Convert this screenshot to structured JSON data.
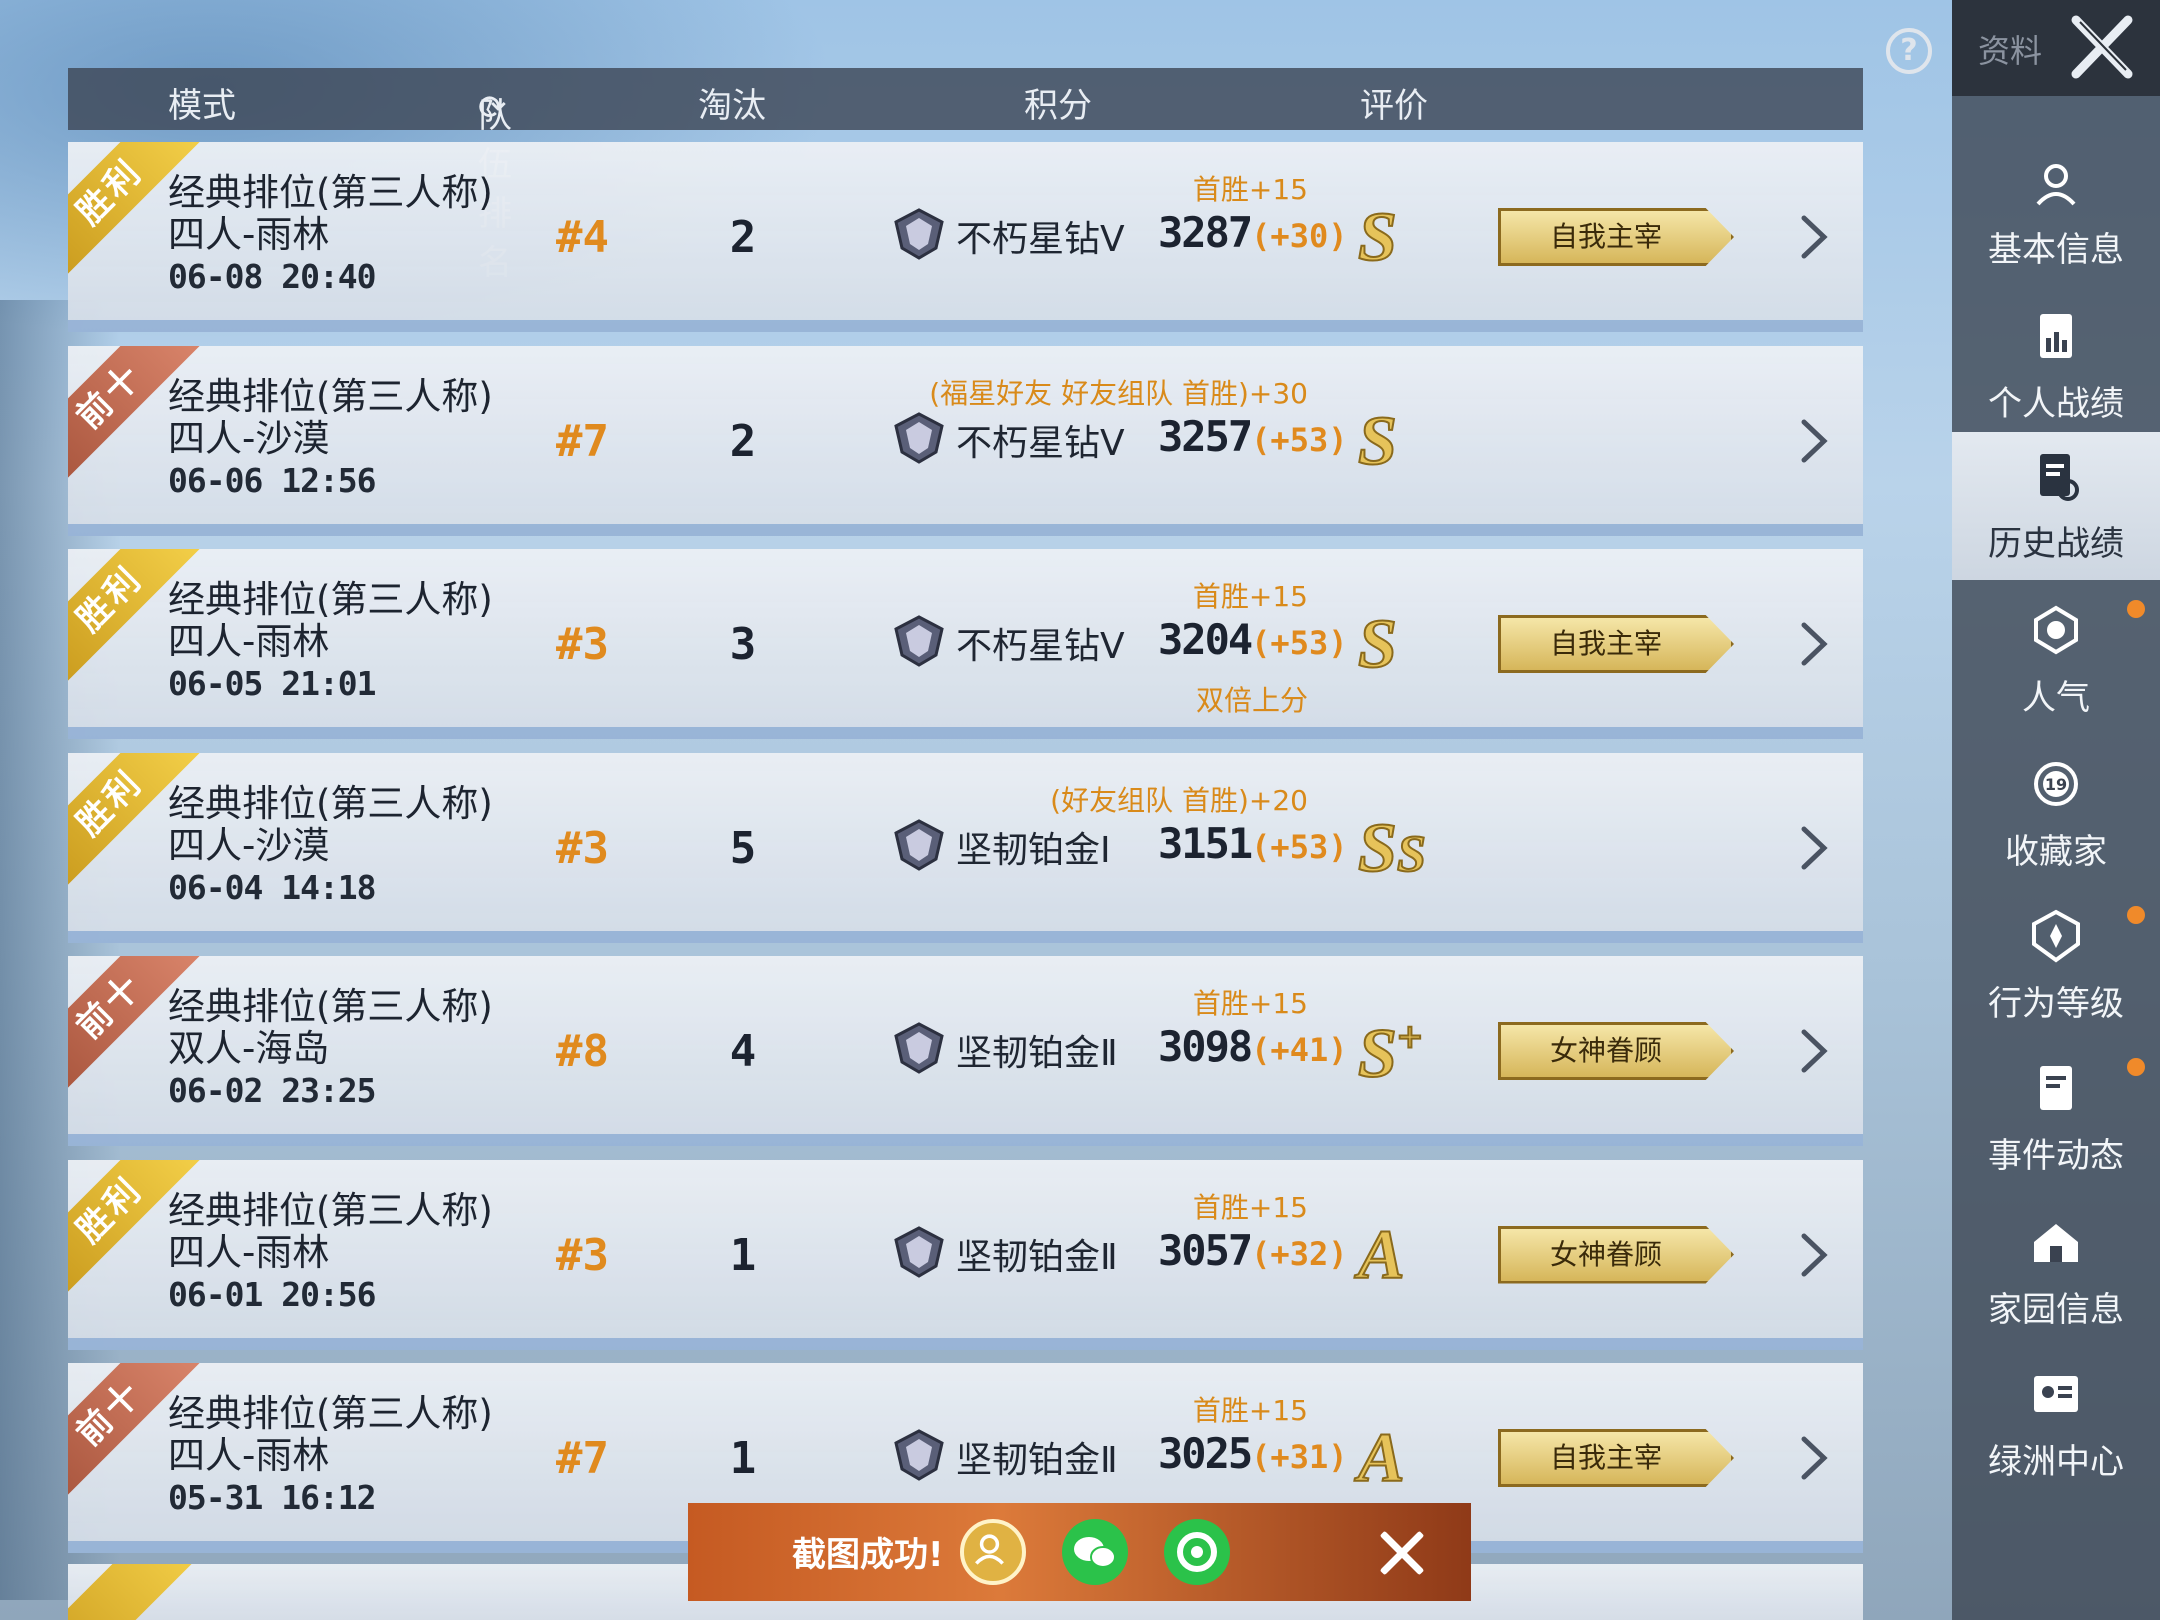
{
  "header": {
    "mode": "模式",
    "team_rank": "队伍排名",
    "kills": "淘汰",
    "score": "积分",
    "rating": "评价"
  },
  "rows": [
    {
      "ribbon": "胜利",
      "ribbon_type": "win",
      "mode": "经典排位(第三人称)",
      "map": "四人-雨林",
      "time": "06-08 20:40",
      "rank": "#4",
      "kills": "2",
      "bonus": "首胜+15",
      "tier": "不朽星钻Ⅴ",
      "score": "3287",
      "delta": "(+30)",
      "grade": "S",
      "badge": "自我主宰",
      "double": ""
    },
    {
      "ribbon": "前十",
      "ribbon_type": "top10",
      "mode": "经典排位(第三人称)",
      "map": "四人-沙漠",
      "time": "06-06 12:56",
      "rank": "#7",
      "kills": "2",
      "bonus": "(福星好友 好友组队 首胜)+30",
      "tier": "不朽星钻Ⅴ",
      "score": "3257",
      "delta": "(+53)",
      "grade": "S",
      "badge": "",
      "double": ""
    },
    {
      "ribbon": "胜利",
      "ribbon_type": "win",
      "mode": "经典排位(第三人称)",
      "map": "四人-雨林",
      "time": "06-05 21:01",
      "rank": "#3",
      "kills": "3",
      "bonus": "首胜+15",
      "tier": "不朽星钻Ⅴ",
      "score": "3204",
      "delta": "(+53)",
      "grade": "S",
      "badge": "自我主宰",
      "double": "双倍上分"
    },
    {
      "ribbon": "胜利",
      "ribbon_type": "win",
      "mode": "经典排位(第三人称)",
      "map": "四人-沙漠",
      "time": "06-04 14:18",
      "rank": "#3",
      "kills": "5",
      "bonus": "(好友组队 首胜)+20",
      "tier": "坚韧铂金Ⅰ",
      "score": "3151",
      "delta": "(+53)",
      "grade": "SS",
      "badge": "",
      "double": ""
    },
    {
      "ribbon": "前十",
      "ribbon_type": "top10",
      "mode": "经典排位(第三人称)",
      "map": "双人-海岛",
      "time": "06-02 23:25",
      "rank": "#8",
      "kills": "4",
      "bonus": "首胜+15",
      "tier": "坚韧铂金Ⅱ",
      "score": "3098",
      "delta": "(+41)",
      "grade": "S+",
      "badge": "女神眷顾",
      "double": ""
    },
    {
      "ribbon": "胜利",
      "ribbon_type": "win",
      "mode": "经典排位(第三人称)",
      "map": "四人-雨林",
      "time": "06-01 20:56",
      "rank": "#3",
      "kills": "1",
      "bonus": "首胜+15",
      "tier": "坚韧铂金Ⅱ",
      "score": "3057",
      "delta": "(+32)",
      "grade": "A",
      "badge": "女神眷顾",
      "double": ""
    },
    {
      "ribbon": "前十",
      "ribbon_type": "top10",
      "mode": "经典排位(第三人称)",
      "map": "四人-雨林",
      "time": "05-31 16:12",
      "rank": "#7",
      "kills": "1",
      "bonus": "首胜+15",
      "tier": "坚韧铂金Ⅱ",
      "score": "3025",
      "delta": "(+31)",
      "grade": "A",
      "badge": "自我主宰",
      "double": ""
    }
  ],
  "sidebar": {
    "title": "资料",
    "items": [
      {
        "label": "基本信息",
        "icon": "profile-icon",
        "dot": false
      },
      {
        "label": "个人战绩",
        "icon": "stats-icon",
        "dot": false
      },
      {
        "label": "历史战绩",
        "icon": "history-icon",
        "dot": false
      },
      {
        "label": "人气",
        "icon": "popularity-icon",
        "dot": true
      },
      {
        "label": "收藏家",
        "icon": "collector-icon",
        "dot": false
      },
      {
        "label": "行为等级",
        "icon": "behavior-icon",
        "dot": true
      },
      {
        "label": "事件动态",
        "icon": "events-icon",
        "dot": true
      },
      {
        "label": "家园信息",
        "icon": "home-icon",
        "dot": false
      },
      {
        "label": "绿洲中心",
        "icon": "oasis-icon",
        "dot": false
      }
    ],
    "active_index": 2,
    "collector_level": "19"
  },
  "toast": {
    "text": "截图成功!",
    "buttons": [
      "friend-share-icon",
      "wechat-icon",
      "moments-icon",
      "close-icon"
    ]
  },
  "colors": {
    "accent_orange": "#e08a1e",
    "win_gold": "#f3cf48",
    "top10_red": "#d9846a",
    "sidebar_bg": "#3a4250"
  }
}
